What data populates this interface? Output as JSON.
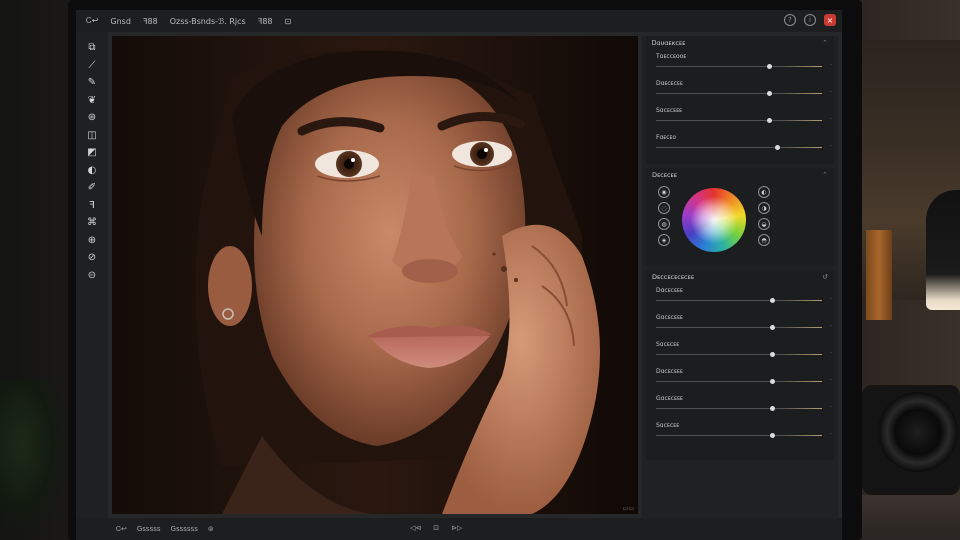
{
  "menubar": {
    "items": [
      "Ꮯ↩",
      "Gnsd",
      "ꟻ88",
      "Ozss-Bsnds-ℬ. Rjcs",
      "ꟻ88",
      "⊡"
    ],
    "right_icons": [
      "help-icon",
      "info-icon",
      "close-icon"
    ]
  },
  "toolbar": {
    "tools": [
      {
        "name": "move-tool-icon",
        "glyph": "⧉"
      },
      {
        "name": "crop-tool-icon",
        "glyph": "⟋"
      },
      {
        "name": "brush-tool-icon",
        "glyph": "✎"
      },
      {
        "name": "heal-tool-icon",
        "glyph": "❦"
      },
      {
        "name": "clone-tool-icon",
        "glyph": "⊛"
      },
      {
        "name": "gradient-tool-icon",
        "glyph": "◫"
      },
      {
        "name": "mask-tool-icon",
        "glyph": "◩"
      },
      {
        "name": "dodge-tool-icon",
        "glyph": "◐"
      },
      {
        "name": "burn-tool-icon",
        "glyph": "✐"
      },
      {
        "name": "text-tool-icon",
        "glyph": "ꟻ"
      },
      {
        "name": "shape-tool-icon",
        "glyph": "⌘"
      },
      {
        "name": "eyedropper-tool-icon",
        "glyph": "⊕"
      },
      {
        "name": "zoom-tool-icon",
        "glyph": "⊘"
      },
      {
        "name": "hand-tool-icon",
        "glyph": "⊝"
      }
    ]
  },
  "panel": {
    "basic": {
      "title": "Ꭰɑᴜɑᴇᴋᴄᴇᴇ",
      "sliders": [
        {
          "label": "Tɑᴇᴄᴄᴇᴏᴏᴇ",
          "value": 0.68
        },
        {
          "label": "Dɑᴇᴄᴇᴄᴇᴇ",
          "value": 0.68
        },
        {
          "label": "Sɑᴄᴇᴄᴇᴇᴇ",
          "value": 0.68
        },
        {
          "label": "Fɑᴇᴄᴇᴏ",
          "value": 0.73
        }
      ]
    },
    "color": {
      "title": "Dᴇᴄᴇᴄᴇᴇ"
    },
    "adjust": {
      "title": "Dᴇᴄᴄᴇᴄᴇᴄᴇᴄᴇᴇ",
      "sliders": [
        {
          "label": "Dɑᴄᴇᴄᴇᴇᴇ",
          "value": 0.7
        },
        {
          "label": "Gɑᴄᴇᴄᴇᴇᴇ",
          "value": 0.7
        },
        {
          "label": "Sɑᴄᴇᴄᴇᴇ",
          "value": 0.7
        },
        {
          "label": "Dɑᴄᴇᴄᴇᴇᴇ",
          "value": 0.7
        },
        {
          "label": "Gɑᴄᴇᴄᴇᴇᴇ",
          "value": 0.7
        },
        {
          "label": "Sɑᴄᴇᴄᴇᴇ",
          "value": 0.7
        }
      ]
    }
  },
  "statusbar": {
    "left": [
      "Ꮯ↩",
      "Gsssss",
      "Gssssss",
      "⊚"
    ],
    "center": [
      "◁⊲",
      "⊡",
      "⊳▷"
    ]
  },
  "colors": {
    "accent_close": "#c93b30",
    "panel_bg": "#1c1d1e",
    "app_bg": "#262728"
  }
}
